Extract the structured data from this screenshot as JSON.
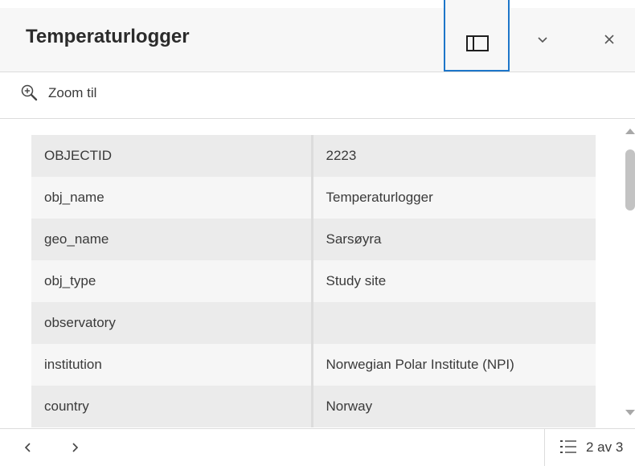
{
  "header": {
    "title": "Temperaturlogger",
    "icons": {
      "dock": "dock-panel-icon",
      "collapse": "chevron-down-icon",
      "close": "close-icon"
    }
  },
  "toolbar": {
    "zoom_label": "Zoom til",
    "zoom_icon": "zoom-in-icon"
  },
  "attributes": [
    {
      "key": "OBJECTID",
      "value": "2223"
    },
    {
      "key": "obj_name",
      "value": "Temperaturlogger"
    },
    {
      "key": "geo_name",
      "value": "Sarsøyra"
    },
    {
      "key": "obj_type",
      "value": "Study site"
    },
    {
      "key": "observatory",
      "value": ""
    },
    {
      "key": "institution",
      "value": "Norwegian Polar Institute (NPI)"
    },
    {
      "key": "country",
      "value": "Norway"
    }
  ],
  "footer": {
    "pager_text": "2 av 3",
    "icons": {
      "prev": "chevron-left-icon",
      "next": "chevron-right-icon",
      "list": "list-icon"
    }
  },
  "colors": {
    "accent": "#1d76c9",
    "row_odd": "#ebebeb",
    "row_even": "#f6f6f6"
  }
}
